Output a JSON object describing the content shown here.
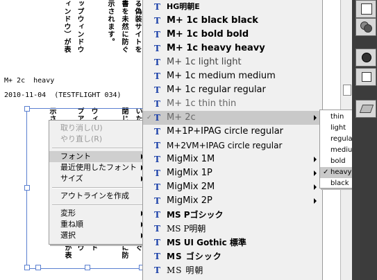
{
  "document": {
    "vertical_columns": [
      "ップウィンドウ",
      "ィンドウ）が表",
      "書を未然に防ぐ",
      "示されます。",
      "る偽装サイトを"
    ],
    "meta_line1": "M+ 2c  heavy",
    "meta_line2": "2010-11-04  (TESTFLIGHT 034)",
    "selected_columns": [
      "示さ",
      "ウ",
      "プア",
      "ウィ",
      "閉じ",
      "いた",
      "は表",
      "バの"
    ],
    "selected_columns_bottom": [
      "が表",
      "ウ",
      "ド",
      "に防",
      "ぐ"
    ]
  },
  "context_menu": {
    "items": [
      {
        "label": "取り消し(U)",
        "disabled": true
      },
      {
        "label": "やり直し(R)",
        "disabled": true
      },
      {
        "label": "フォント",
        "submenu": true,
        "highlighted": true
      },
      {
        "label": "最近使用したフォント",
        "submenu": true
      },
      {
        "label": "サイズ",
        "submenu": true
      },
      {
        "label": "アウトラインを作成"
      },
      {
        "label": "変形",
        "submenu": true
      },
      {
        "label": "重ね順",
        "submenu": true
      },
      {
        "label": "選択",
        "submenu": true
      }
    ]
  },
  "font_menu": {
    "icon_glyph": "T",
    "items": [
      {
        "label": "HG明朝E"
      },
      {
        "label": "M+ 1c black black"
      },
      {
        "label": "M+ 1c bold bold"
      },
      {
        "label": "M+ 1c heavy heavy"
      },
      {
        "label": "M+ 1c light light"
      },
      {
        "label": "M+ 1c medium medium"
      },
      {
        "label": "M+ 1c regular regular"
      },
      {
        "label": "M+ 1c thin thin"
      },
      {
        "label": "M+ 2c",
        "submenu": true,
        "highlighted": true,
        "checked": true
      },
      {
        "label": "M+1P+IPAG circle regular"
      },
      {
        "label": "M+2VM+IPAG circle regular"
      },
      {
        "label": "MigMix 1M",
        "submenu": true
      },
      {
        "label": "MigMix 1P",
        "submenu": true
      },
      {
        "label": "MigMix 2M",
        "submenu": true
      },
      {
        "label": "MigMix 2P",
        "submenu": true
      },
      {
        "label": "MS Pゴシック"
      },
      {
        "label": "MS P明朝"
      },
      {
        "label": "MS UI Gothic 標準"
      },
      {
        "label": "MS ゴシック"
      },
      {
        "label": "MS 明朝"
      }
    ]
  },
  "weight_menu": {
    "items": [
      {
        "label": "thin"
      },
      {
        "label": "light"
      },
      {
        "label": "regular"
      },
      {
        "label": "medium"
      },
      {
        "label": "bold"
      },
      {
        "label": "heavy",
        "checked": true,
        "highlighted": true
      },
      {
        "label": "black"
      }
    ],
    "check_glyph": "✓"
  }
}
